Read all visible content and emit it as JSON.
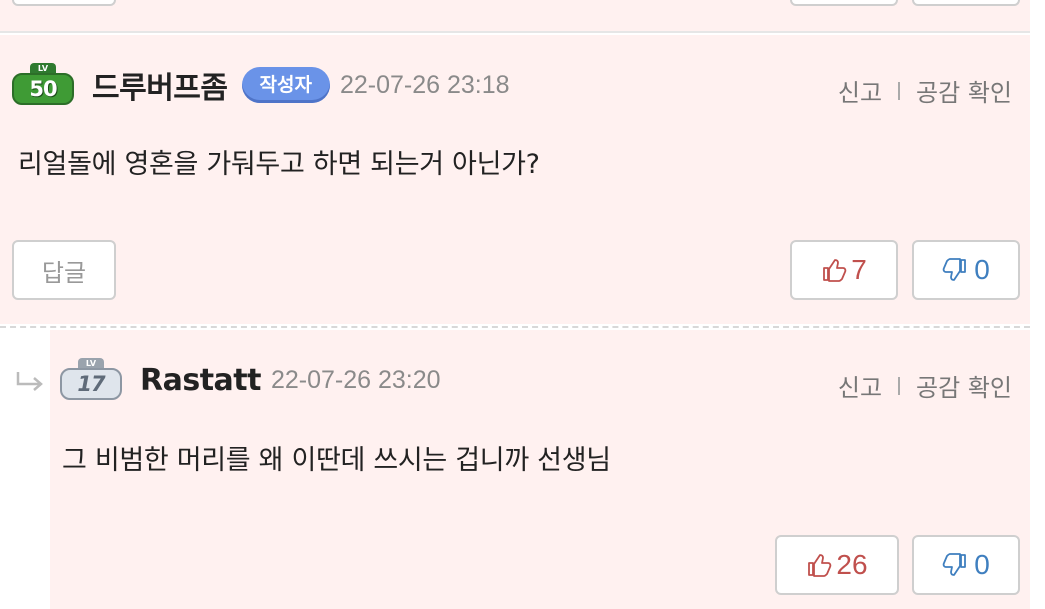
{
  "comments": [
    {
      "level": "50",
      "level_cap": "LV",
      "author": "드루버프좀",
      "badge": "작성자",
      "time": "22-07-26 23:18",
      "report": "신고",
      "check_likes": "공감 확인",
      "text": "리얼돌에 영혼을 가둬두고 하면 되는거 아닌가?",
      "reply_label": "답글",
      "likes": "7",
      "dislikes": "0"
    },
    {
      "level": "17",
      "level_cap": "LV",
      "author": "Rastatt",
      "time": "22-07-26 23:20",
      "report": "신고",
      "check_likes": "공감 확인",
      "text": "그 비범한 머리를 왜 이딴데 쓰시는 겁니까 선생님",
      "likes": "26",
      "dislikes": "0"
    }
  ],
  "colors": {
    "comment_bg": "#fff1f0",
    "badge_bg": "#6a93e8",
    "like": "#c0504d",
    "dislike": "#3f7fbf"
  },
  "icons": {
    "thumb_up": "thumbs-up-icon",
    "thumb_down": "thumbs-down-icon",
    "reply_arrow": "reply-arrow-icon"
  }
}
